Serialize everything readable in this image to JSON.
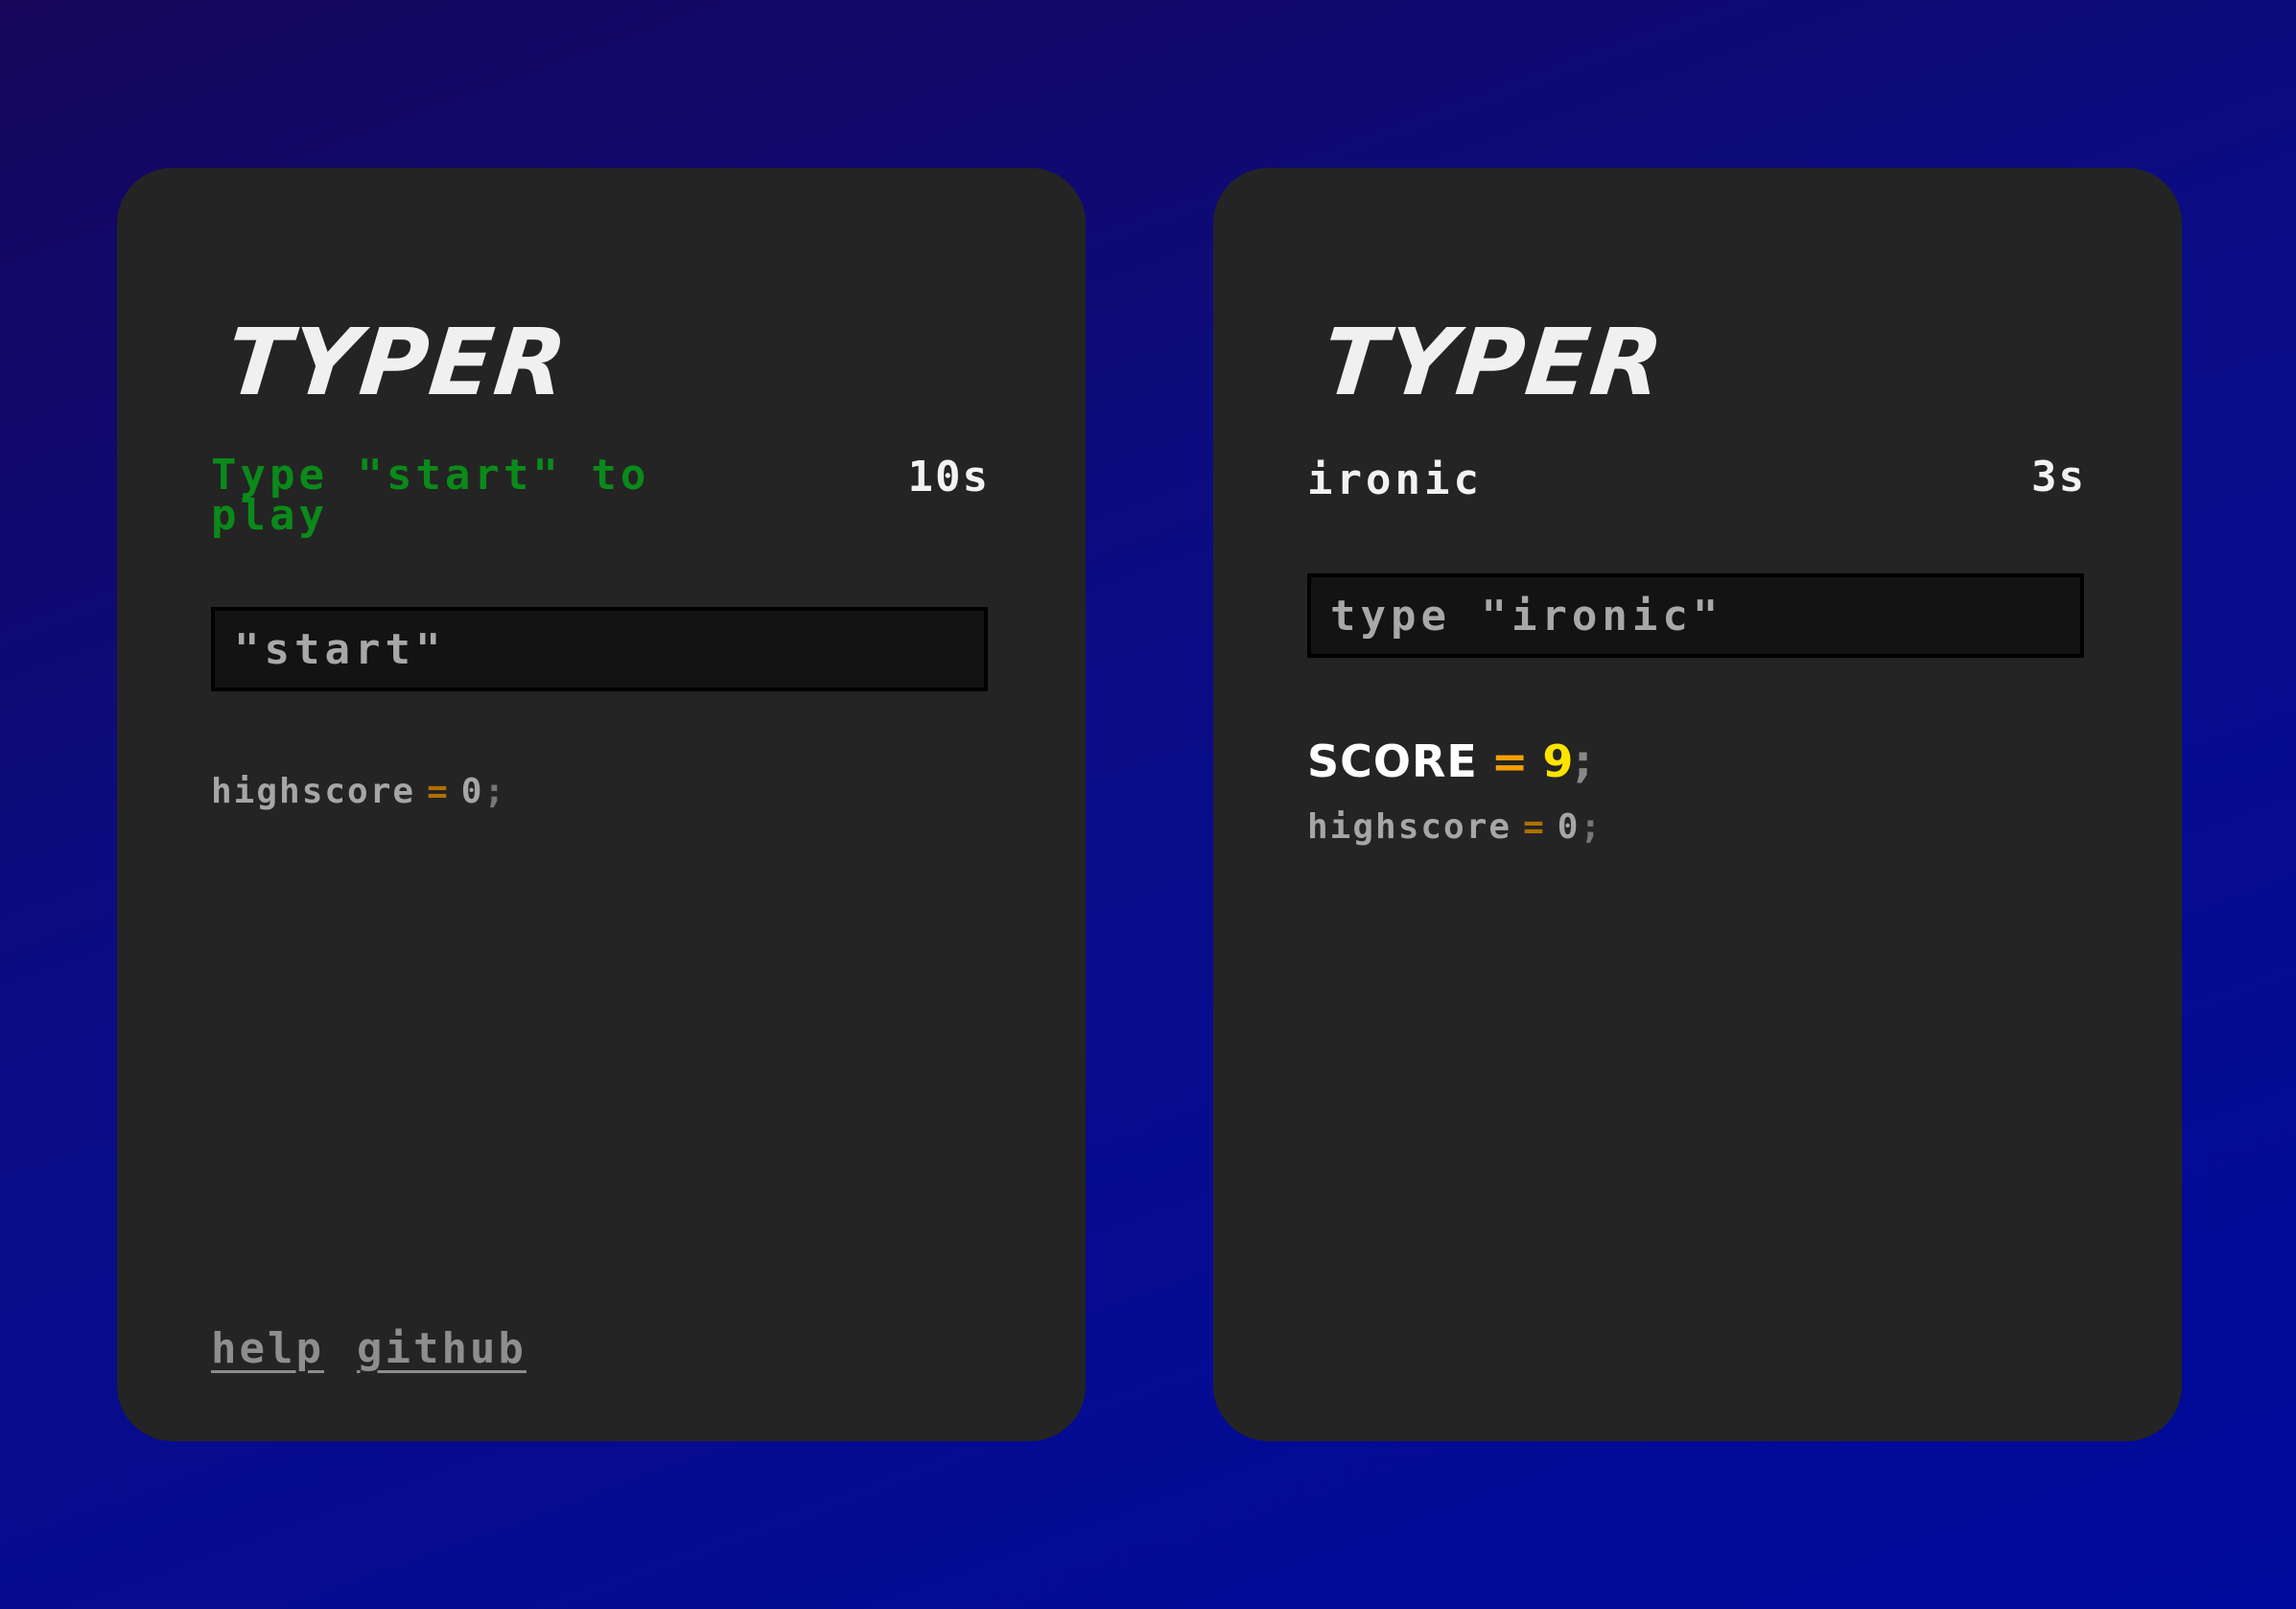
{
  "colors": {
    "background_top": "#15065a",
    "background_bottom": "#000a9c",
    "card": "#242424",
    "prompt_green": "#0a8a1a",
    "equals_orange": "#f5a000",
    "score_yellow": "#ffe300"
  },
  "start_screen": {
    "title": "TYPER",
    "prompt": "Type \"start\" to play",
    "timer": "10s",
    "input_value": "\"start\"",
    "highscore": {
      "label": "highscore",
      "equals": "=",
      "value": "0",
      "terminator": ";"
    },
    "links": {
      "help": "help",
      "github": "github"
    }
  },
  "game_screen": {
    "title": "TYPER",
    "word": "ironic",
    "timer": "3s",
    "input_placeholder": "type \"ironic\"",
    "score": {
      "label": "SCORE",
      "equals": "=",
      "value": "9",
      "terminator": ";"
    },
    "highscore": {
      "label": "highscore",
      "equals": "=",
      "value": "0",
      "terminator": ";"
    }
  }
}
